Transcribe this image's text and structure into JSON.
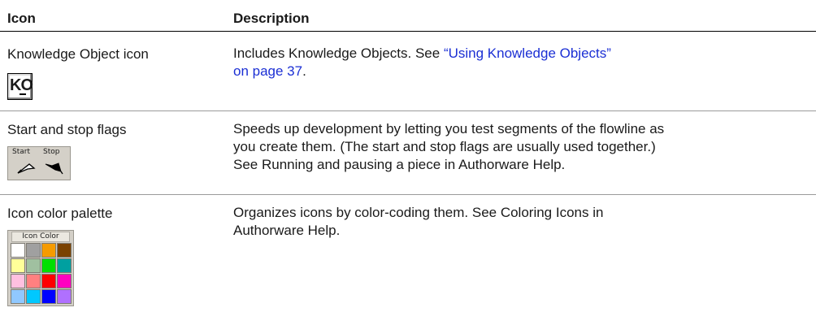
{
  "table": {
    "headers": {
      "icon": "Icon",
      "description": "Description"
    },
    "rows": [
      {
        "name": "Knowledge Object icon",
        "desc_text": "Includes Knowledge Objects. See ",
        "desc_link_line1": "“Using Knowledge Objects”",
        "desc_link_line2": "on page 37",
        "desc_after_link": ".",
        "icon_glyph": "KO"
      },
      {
        "name": "Start and stop flags",
        "desc_lines": [
          "Speeds up development by letting you test segments of the flowline as",
          "you create them. (The start and stop flags are usually used together.)",
          "See Running and pausing a piece in Authorware Help."
        ],
        "flag_labels": {
          "start": "Start",
          "stop": "Stop"
        }
      },
      {
        "name": "Icon color palette",
        "desc_lines": [
          "Organizes icons by color-coding them. See Coloring Icons in",
          "Authorware Help."
        ],
        "palette_title": "Icon Color",
        "palette_colors": [
          "#ffffff",
          "#a0a0a0",
          "#f59b00",
          "#7a4200",
          "#ffff99",
          "#a0c0a0",
          "#00e000",
          "#00a0a0",
          "#ffc0e0",
          "#ff8080",
          "#ff0000",
          "#ff00c0",
          "#90c8ff",
          "#00c8ff",
          "#0000ff",
          "#b070ff"
        ]
      }
    ]
  }
}
